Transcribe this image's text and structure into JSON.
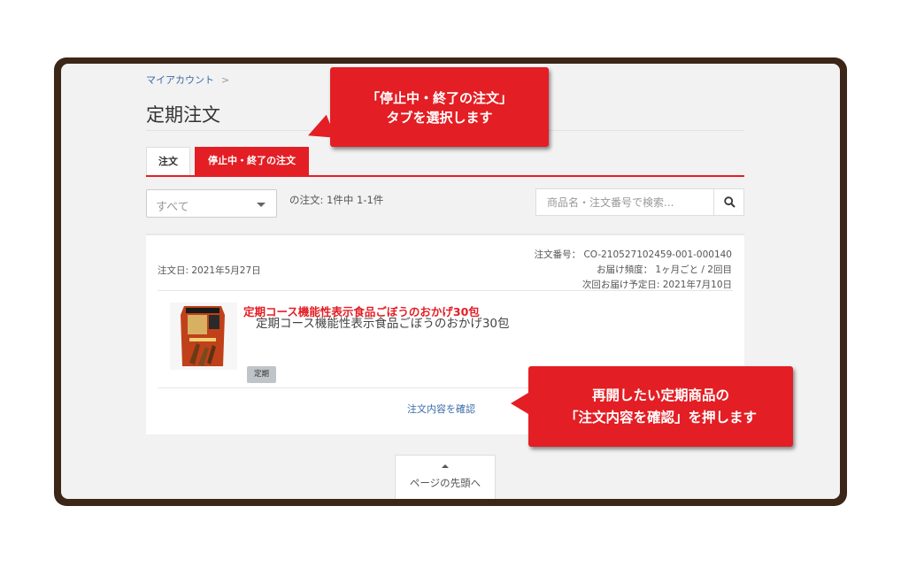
{
  "breadcrumb": {
    "item": "マイアカウント",
    "separator": ">"
  },
  "page_title": "定期注文",
  "tabs": [
    {
      "label": "注文"
    },
    {
      "label": "停止中・終了の注文",
      "active": true
    }
  ],
  "filter": {
    "selected": "すべて"
  },
  "order_count": "の注文: 1件中 1-1件",
  "search": {
    "placeholder": "商品名・注文番号で検索..."
  },
  "order": {
    "date": "注文日: 2021年5月27日",
    "number": "注文番号： CO-210527102459-001-000140",
    "frequency": "お届け頻度： 1ヶ月ごと / 2回目",
    "next_delivery": "次回お届け予定日: 2021年7月10日",
    "product_title": "定期コース機能性表示食品ごぼうのおかげ30包",
    "product_desc": "定期コース機能性表示食品ごぼうのおかげ30包",
    "badge": "定期",
    "link": "注文内容を確認"
  },
  "scroll_top": {
    "label": "ページの先頭へ"
  },
  "callouts": {
    "tab_line1": "「停止中・終了の注文」",
    "tab_line2": "タブを選択します",
    "detail_line1": "再開したい定期商品の",
    "detail_line2": "「注文内容を確認」を押します"
  },
  "colors": {
    "accent": "#e31e24",
    "frame": "#3c2618",
    "link": "#3a6aa8"
  },
  "icons": {
    "search": "search-icon"
  }
}
